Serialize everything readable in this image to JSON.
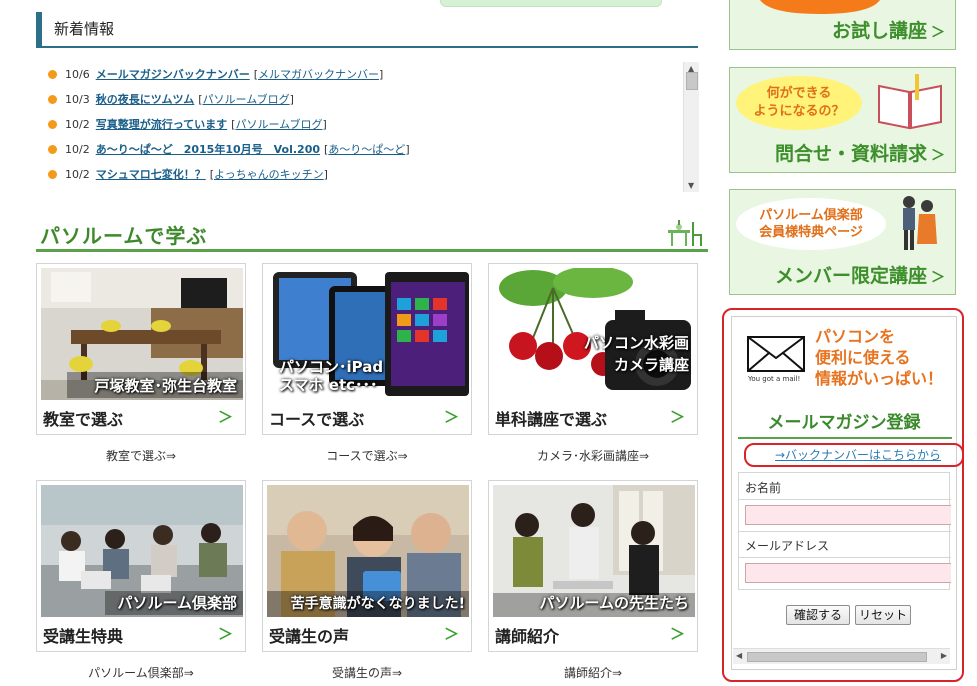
{
  "news": {
    "heading": "新着情報",
    "items": [
      {
        "date": "10/6",
        "title": "メールマガジンバックナンバー",
        "category": "メルマガバックナンバー"
      },
      {
        "date": "10/3",
        "title": "秋の夜長にツムツム",
        "category": "パソルームブログ"
      },
      {
        "date": "10/2",
        "title": "写真整理が流行っています",
        "category": "パソルームブログ"
      },
      {
        "date": "10/2",
        "title": "あ〜り〜ぱ〜ど　2015年10月号　Vol.200",
        "category": "あ〜り〜ぱ〜ど"
      },
      {
        "date": "10/2",
        "title": "マシュマロ七変化！？",
        "category": "よっちゃんのキッチン"
      }
    ]
  },
  "learn": {
    "title": "パソルームで学ぶ",
    "cards": [
      {
        "caption": "戸塚教室･弥生台教室",
        "label": "教室で選ぶ",
        "link": "教室で選ぶ⇒"
      },
      {
        "caption": "パソコン･iPad\nスマホ etc･･･",
        "label": "コースで選ぶ",
        "link": "コースで選ぶ⇒"
      },
      {
        "caption": "パソコン水彩画\nカメラ講座",
        "label": "単科講座で選ぶ",
        "link": "カメラ･水彩画講座⇒"
      },
      {
        "caption": "パソルーム倶楽部",
        "label": "受講生特典",
        "link": "パソルーム倶楽部⇒"
      },
      {
        "caption": "苦手意識がなくなりました!",
        "label": "受講生の声",
        "link": "受講生の声⇒"
      },
      {
        "caption": "パソルームの先生たち",
        "label": "講師紹介",
        "link": "講師紹介⇒"
      }
    ],
    "arrow": "＞"
  },
  "side": {
    "trial": {
      "label": "お試し講座"
    },
    "inquiry": {
      "bubble": "何ができる\nようになるの？",
      "label": "問合せ・資料請求"
    },
    "member": {
      "bubble": "パソルーム倶楽部\n会員様特典ページ",
      "label": "メンバー限定講座"
    },
    "arrow": "＞"
  },
  "mail": {
    "envelope_caption": "You got a mail!",
    "promo": "パソコンを\n便利に使える\n情報がいっぱい！",
    "title": "メールマガジン登録",
    "back_number_link": "→バックナンバーはこちらから",
    "name_label": "お名前",
    "email_label": "メールアドレス",
    "name_value": "",
    "email_value": "",
    "confirm_label": "確認する",
    "reset_label": "リセット"
  },
  "colors": {
    "accent_green": "#3d8a2a",
    "accent_orange": "#e8731f",
    "highlight_red": "#d8232a",
    "link_blue": "#1a5f8a"
  }
}
